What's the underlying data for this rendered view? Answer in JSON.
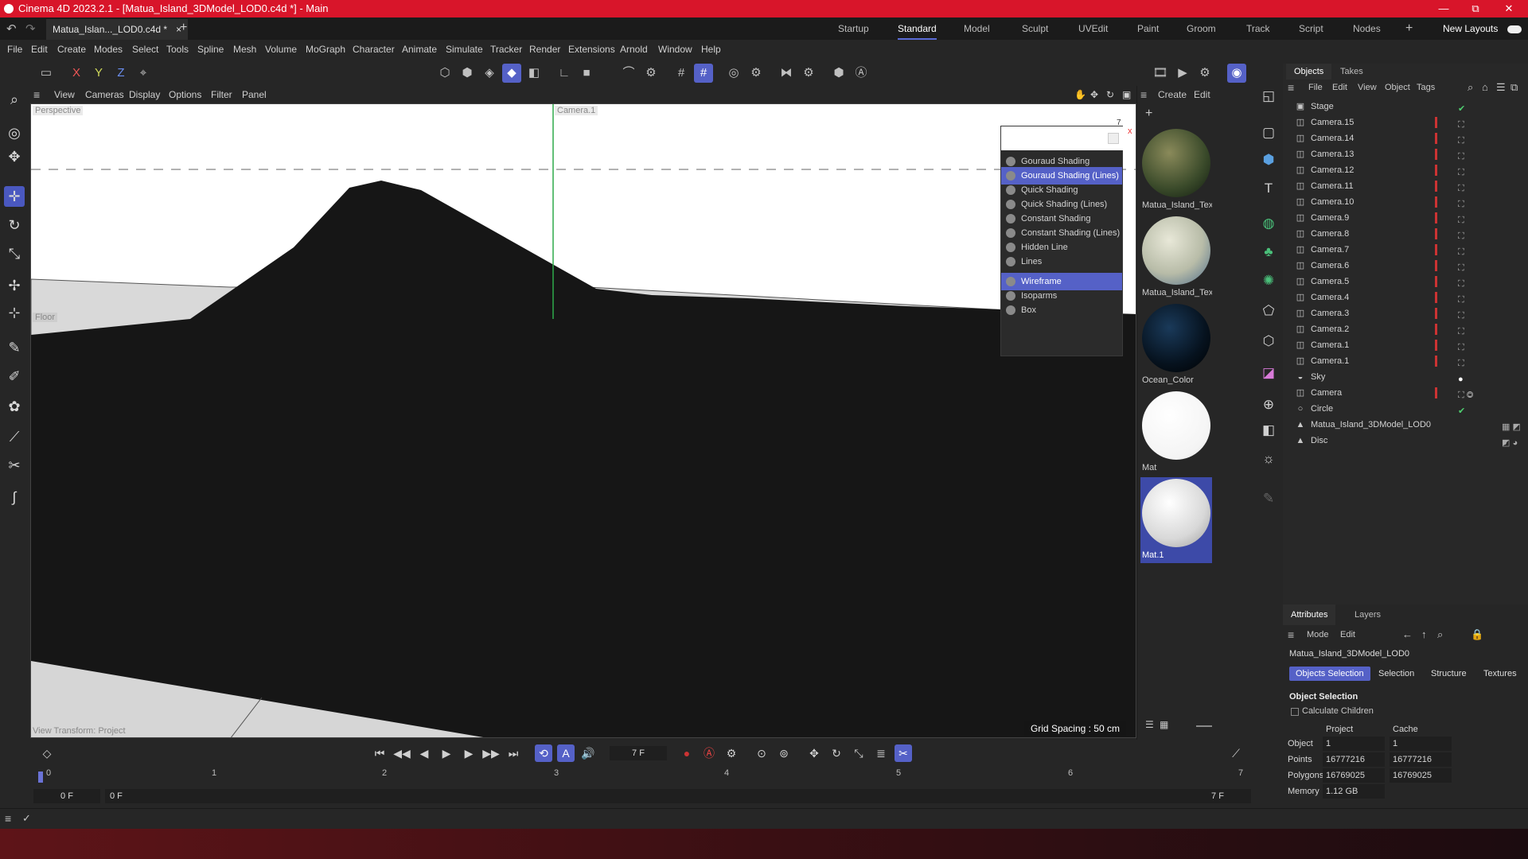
{
  "app": {
    "title": "Cinema 4D 2023.2.1 - [Matua_Island_3DModel_LOD0.c4d *] - Main",
    "doc_tab": "Matua_Islan..._LOD0.c4d *",
    "doc_tab_close": "×",
    "add_tab": "+",
    "win_min": "—",
    "win_max": "⧉",
    "win_close": "✕"
  },
  "layouts": {
    "items": [
      "Startup",
      "Standard",
      "Model",
      "Sculpt",
      "UVEdit",
      "Paint",
      "Groom",
      "Track",
      "Script",
      "Nodes"
    ],
    "active": "Standard",
    "add": "+",
    "new_layouts": "New Layouts"
  },
  "menu": [
    "File",
    "Edit",
    "Create",
    "Modes",
    "Select",
    "Tools",
    "Spline",
    "Mesh",
    "Volume",
    "MoGraph",
    "Character",
    "Animate",
    "Simulate",
    "Tracker",
    "Render",
    "Extensions",
    "Arnold",
    "Window",
    "Help"
  ],
  "toolbar": {
    "x": "X",
    "y": "Y",
    "z": "Z"
  },
  "viewport_menu": [
    "View",
    "Cameras",
    "Display",
    "Options",
    "Filter",
    "Panel"
  ],
  "viewport": {
    "label_tl": "Perspective",
    "label_mid": "Camera.1",
    "label_left": "Floor",
    "frame_num": "7",
    "close": "x",
    "grid_spacing": "Grid Spacing : 50 cm",
    "view_transform": "View Transform: Project"
  },
  "display_menu": {
    "items": [
      {
        "label": "Gouraud Shading",
        "on": false
      },
      {
        "label": "Gouraud Shading (Lines)",
        "on": true
      },
      {
        "label": "Quick Shading",
        "on": false
      },
      {
        "label": "Quick Shading (Lines)",
        "on": false
      },
      {
        "label": "Constant Shading",
        "on": false
      },
      {
        "label": "Constant Shading (Lines)",
        "on": false
      },
      {
        "label": "Hidden Line",
        "on": false
      },
      {
        "label": "Lines",
        "on": false
      },
      {
        "label": "Wireframe",
        "on": true
      },
      {
        "label": "Isoparms",
        "on": false
      },
      {
        "label": "Box",
        "on": false
      }
    ]
  },
  "materials": {
    "menu": [
      "Create",
      "Edit"
    ],
    "items": [
      {
        "name": "Matua_Island_Text"
      },
      {
        "name": "Matua_Island_Text"
      },
      {
        "name": "Ocean_Color"
      },
      {
        "name": "Mat"
      },
      {
        "name": "Mat.1"
      }
    ]
  },
  "objects": {
    "tabs": [
      "Objects",
      "Takes"
    ],
    "menu": [
      "File",
      "Edit",
      "View",
      "Object",
      "Tags"
    ],
    "rows": [
      {
        "name": "Stage"
      },
      {
        "name": "Camera.15"
      },
      {
        "name": "Camera.14"
      },
      {
        "name": "Camera.13"
      },
      {
        "name": "Camera.12"
      },
      {
        "name": "Camera.11"
      },
      {
        "name": "Camera.10"
      },
      {
        "name": "Camera.9"
      },
      {
        "name": "Camera.8"
      },
      {
        "name": "Camera.7"
      },
      {
        "name": "Camera.6"
      },
      {
        "name": "Camera.5"
      },
      {
        "name": "Camera.4"
      },
      {
        "name": "Camera.3"
      },
      {
        "name": "Camera.2"
      },
      {
        "name": "Camera.1"
      },
      {
        "name": "Camera.1"
      },
      {
        "name": "Sky"
      },
      {
        "name": "Camera"
      },
      {
        "name": "Circle"
      },
      {
        "name": "Matua_Island_3DModel_LOD0"
      },
      {
        "name": "Disc"
      }
    ]
  },
  "attributes": {
    "tabs": [
      "Attributes",
      "Layers"
    ],
    "menu": [
      "Mode",
      "Edit"
    ],
    "object_name": "Matua_Island_3DModel_LOD0",
    "buttons": [
      "Objects Selection",
      "Selection",
      "Structure",
      "Textures"
    ],
    "section": "Object Selection",
    "calc_children": "Calculate Children",
    "col_project": "Project",
    "col_cache": "Cache",
    "rows": [
      {
        "label": "Object",
        "project": "1",
        "cache": "1"
      },
      {
        "label": "Points",
        "project": "16777216",
        "cache": "16777216"
      },
      {
        "label": "Polygons",
        "project": "16769025",
        "cache": "16769025"
      },
      {
        "label": "Memory",
        "project": "1.12 GB",
        "cache": ""
      }
    ]
  },
  "timeline": {
    "current_frame": "7 F",
    "ruler": [
      "0",
      "1",
      "2",
      "3",
      "4",
      "5",
      "6",
      "7"
    ],
    "start": "0 F",
    "start2": "0 F",
    "end": "7 F",
    "end2": "7 F"
  }
}
